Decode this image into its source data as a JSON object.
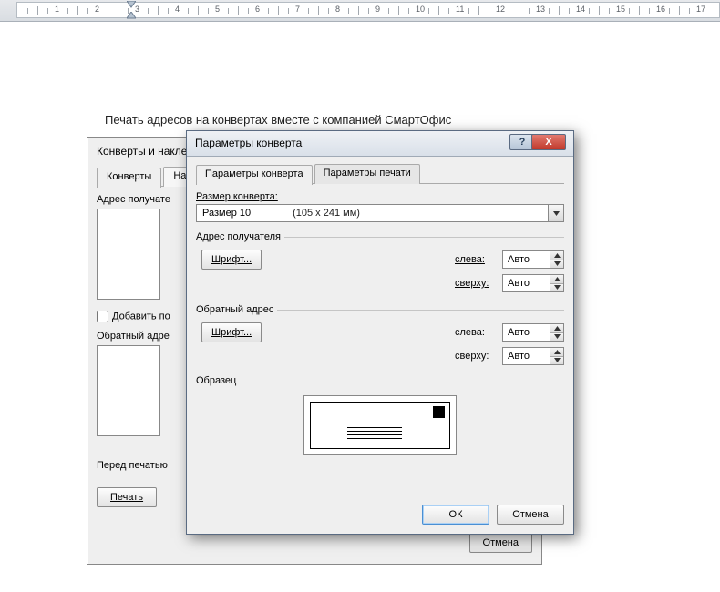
{
  "doc_heading": "Печать адресов на конвертах вместе с компанией СмартОфис",
  "back_dialog": {
    "title": "Конверты и накле",
    "tabs": {
      "envelopes": "Конверты",
      "labels_partial": "На"
    },
    "recipient_label": "Адрес получате",
    "add_checkbox": "Добавить по",
    "return_label": "Обратный адре",
    "before_print": "Перед печатью",
    "print_btn": "Печать",
    "cancel_btn": "Отмена"
  },
  "front_dialog": {
    "title": "Параметры конверта",
    "help_symbol": "?",
    "close_symbol": "Х",
    "tabs": {
      "options": "Параметры конверта",
      "print": "Параметры  печати"
    },
    "size_label": "Размер конверта:",
    "size_value": "Размер 10",
    "size_dim": "(105 x 241 мм)",
    "recipient_group": "Адрес получателя",
    "return_group": "Обратный адрес",
    "font_btn": "Шрифт...",
    "left_lbl": "слева:",
    "top_lbl": "сверху:",
    "auto": "Авто",
    "preview_lbl": "Образец",
    "ok": "ОК",
    "cancel": "Отмена"
  },
  "ruler": {
    "max": 17
  }
}
